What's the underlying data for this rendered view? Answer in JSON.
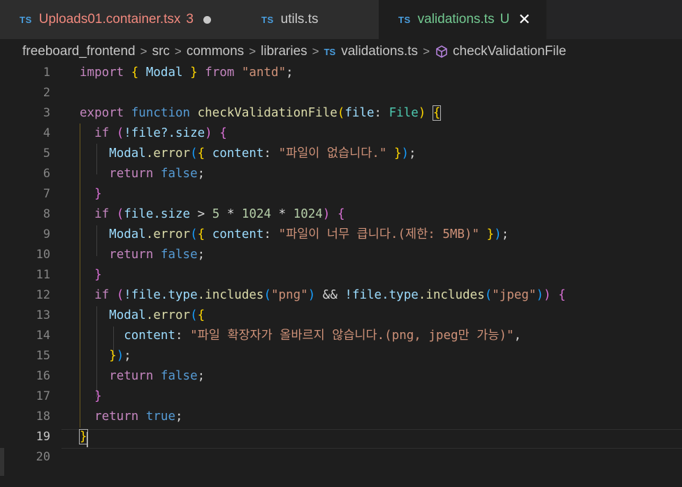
{
  "tabs": [
    {
      "icon": "TS",
      "name": "Uploads01.container.tsx",
      "badge": "3"
    },
    {
      "icon": "TS",
      "name": "utils.ts"
    },
    {
      "icon": "TS",
      "name": "validations.ts",
      "status": "U",
      "close": "✕"
    }
  ],
  "breadcrumbs": {
    "items": [
      "freeboard_frontend",
      "src",
      "commons",
      "libraries"
    ],
    "file_icon": "TS",
    "file": "validations.ts",
    "symbol": "checkValidationFile",
    "separator": ">"
  },
  "editor": {
    "line_numbers": [
      "1",
      "2",
      "3",
      "4",
      "5",
      "6",
      "7",
      "8",
      "9",
      "10",
      "11",
      "12",
      "13",
      "14",
      "15",
      "16",
      "17",
      "18",
      "19",
      "20"
    ],
    "active_line": "19",
    "code": {
      "l1": {
        "import": "import",
        "b_open": "{",
        "modal": "Modal",
        "b_close": "}",
        "from": "from",
        "module": "\"antd\"",
        "semi": ";"
      },
      "l3": {
        "export": "export",
        "function": "function",
        "name": "checkValidationFile",
        "p_open": "(",
        "param": "file",
        "colon": ":",
        "type": "File",
        "p_close": ")",
        "brace": "{"
      },
      "l4": {
        "if": "if",
        "p_open": "(",
        "cond": "!file?.size",
        "p_close": ")",
        "brace": "{"
      },
      "l5": {
        "obj": "Modal",
        "call": ".error",
        "p_open": "(",
        "b_open": "{",
        "key": "content",
        "colon": ":",
        "msg": "\"파일이 없습니다.\"",
        "b_close": "}",
        "p_close": ")",
        "semi": ";"
      },
      "l6": {
        "return": "return",
        "val": "false",
        "semi": ";"
      },
      "l7": {
        "brace": "}"
      },
      "l8": {
        "if": "if",
        "p_open": "(",
        "cond_a": "file.size",
        "gt": ">",
        "n1": "5",
        "mul1": "*",
        "n2": "1024",
        "mul2": "*",
        "n3": "1024",
        "p_close": ")",
        "brace": "{"
      },
      "l9": {
        "obj": "Modal",
        "call": ".error",
        "p_open": "(",
        "b_open": "{",
        "key": "content",
        "colon": ":",
        "msg": "\"파일이 너무 큽니다.(제한: 5MB)\"",
        "b_close": "}",
        "p_close": ")",
        "semi": ";"
      },
      "l10": {
        "return": "return",
        "val": "false",
        "semi": ";"
      },
      "l11": {
        "brace": "}"
      },
      "l12": {
        "if": "if",
        "p_open": "(",
        "neg1": "!file.",
        "type1": "type",
        "inc1": ".includes",
        "q1_open": "(",
        "s1": "\"png\"",
        "q1_close": ")",
        "and": "&&",
        "neg2": "!file.",
        "type2": "type",
        "inc2": ".includes",
        "q2_open": "(",
        "s2": "\"jpeg\"",
        "q2_close": ")",
        "p_close": ")",
        "brace": "{"
      },
      "l13": {
        "obj": "Modal",
        "call": ".error",
        "p_open": "(",
        "b_open": "{"
      },
      "l14": {
        "key": "content",
        "colon": ":",
        "msg": "\"파일 확장자가 올바르지 않습니다.(png, jpeg만 가능)\"",
        "comma": ","
      },
      "l15": {
        "b_close": "}",
        "p_close": ")",
        "semi": ";"
      },
      "l16": {
        "return": "return",
        "val": "false",
        "semi": ";"
      },
      "l17": {
        "brace": "}"
      },
      "l18": {
        "return": "return",
        "val": "true",
        "semi": ";"
      },
      "l19": {
        "brace": "}"
      }
    }
  },
  "colors": {
    "keyword": "#569cd6",
    "control": "#c586c0",
    "function": "#dcdcaa",
    "string": "#ce9178",
    "variable": "#9cdcfe",
    "type": "#4ec9b0",
    "number": "#b5cea8",
    "modified_tab": "#f1897e",
    "untracked_tab": "#73c991"
  }
}
